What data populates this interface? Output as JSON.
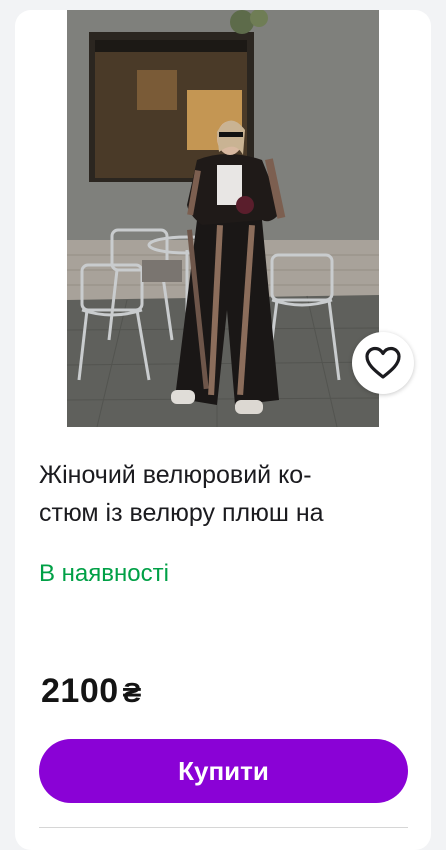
{
  "product": {
    "title_line1": "Жіночий велюровий ко-",
    "title_line2": "стюм із велюру плюш на",
    "availability": "В наявності",
    "price": "2100",
    "currency": "₴",
    "buy_label": "Купити",
    "favorite_icon": "heart-icon",
    "photo_alt": "product-photo"
  },
  "colors": {
    "accent": "#8a02d6",
    "in_stock": "#00a046",
    "text": "#1b1b1f",
    "card_bg": "#ffffff",
    "page_bg": "#f2f3f5"
  }
}
